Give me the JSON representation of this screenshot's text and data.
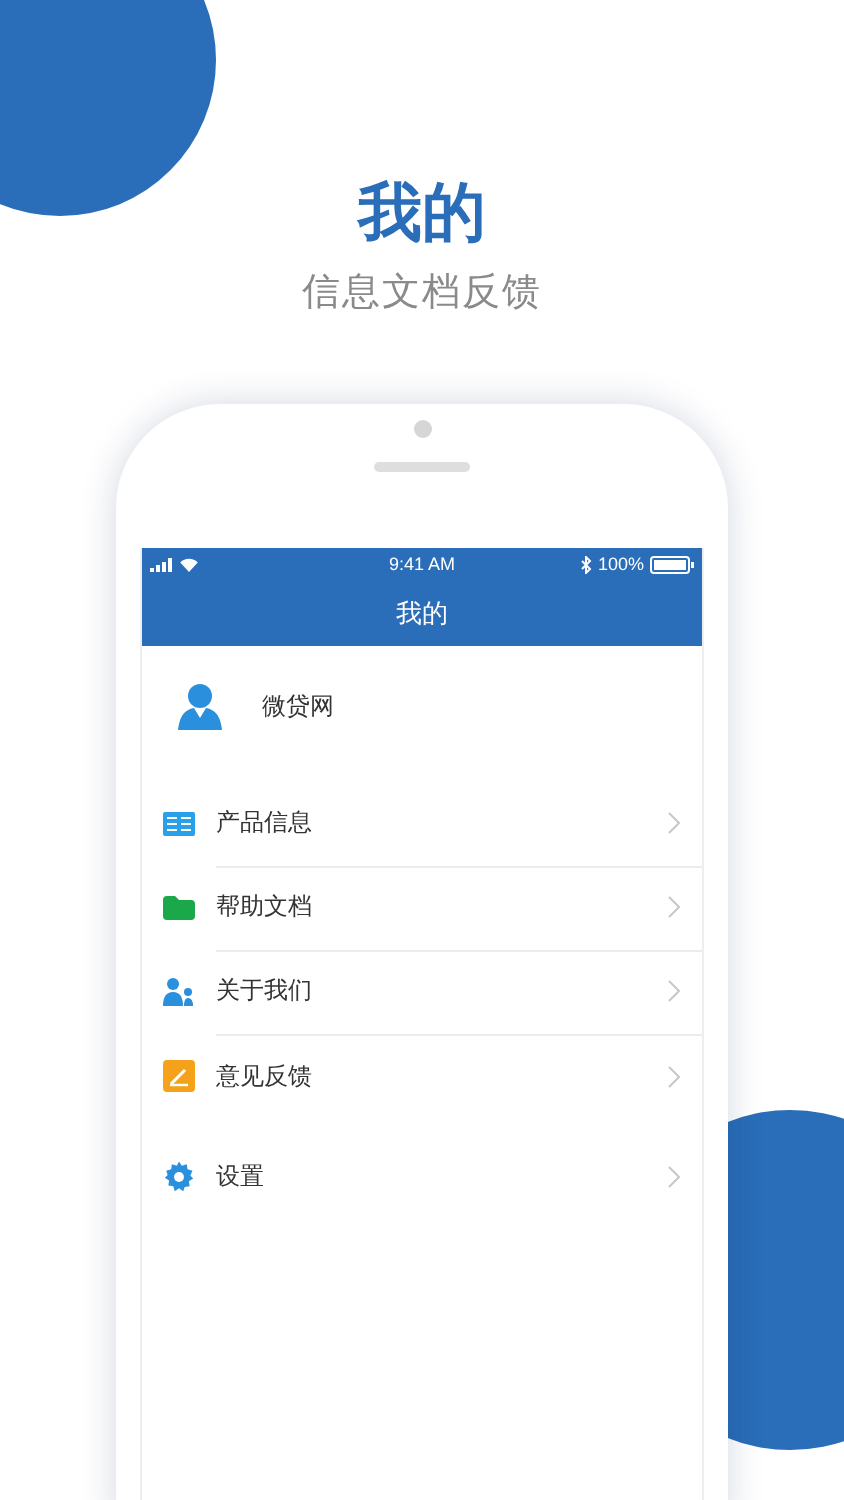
{
  "header": {
    "title": "我的",
    "subtitle": "信息文档反馈"
  },
  "status_bar": {
    "time": "9:41 AM",
    "battery": "100%"
  },
  "nav_bar": {
    "title": "我的"
  },
  "profile": {
    "name": "微贷网"
  },
  "menu_groups": [
    {
      "items": [
        {
          "kind": "book",
          "label": "产品信息"
        },
        {
          "kind": "folder",
          "label": "帮助文档"
        },
        {
          "kind": "people",
          "label": "关于我们"
        },
        {
          "kind": "edit",
          "label": "意见反馈"
        }
      ]
    },
    {
      "items": [
        {
          "kind": "gear",
          "label": "设置"
        }
      ]
    }
  ]
}
